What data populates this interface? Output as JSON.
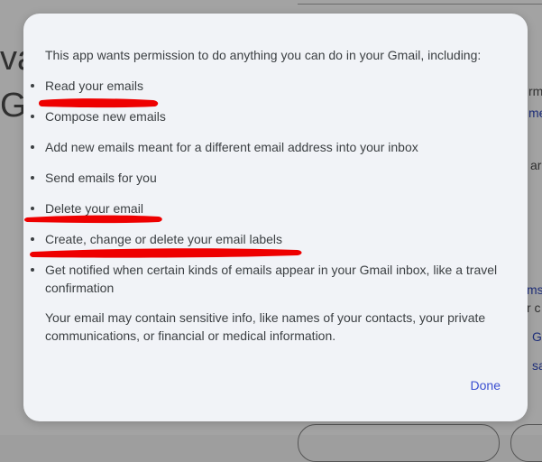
{
  "background": {
    "fragments": [
      "va",
      "Go",
      "rm",
      "me",
      "ar",
      "ms",
      "r c",
      "G",
      "sa"
    ]
  },
  "dialog": {
    "intro": "This app wants permission to do anything you can do in your Gmail, including:",
    "permissions": [
      "Read your emails",
      "Compose new emails",
      "Add new emails meant for a different email address into your inbox",
      "Send emails for you",
      "Delete your email",
      "Create, change or delete your email labels",
      "Get notified when certain kinds of emails appear in your Gmail inbox, like a travel confirmation"
    ],
    "note": "Your email may contain sensitive info, like names of your contacts, your private communications, or financial or medical information.",
    "done_label": "Done"
  },
  "colors": {
    "dialog_background": "#f1f3f7",
    "text": "#3c4043",
    "link": "#3b4fd1",
    "annotation": "#ee0000",
    "scrim": "#a3a3a3"
  }
}
